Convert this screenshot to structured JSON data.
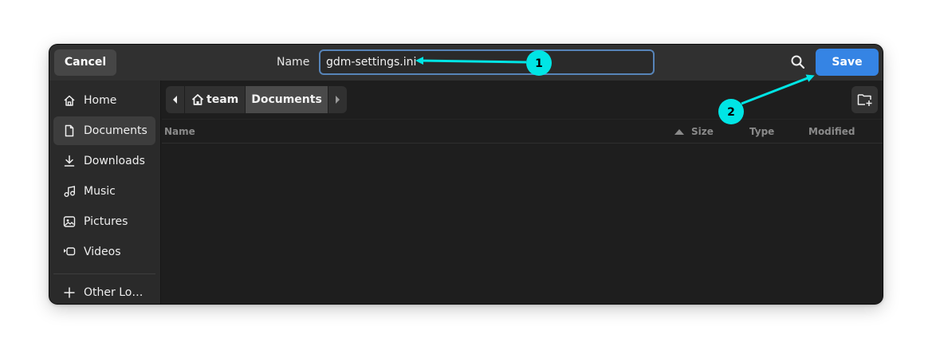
{
  "header": {
    "cancel_label": "Cancel",
    "name_label": "Name",
    "name_value": "gdm-settings.ini",
    "search_icon": "search-icon",
    "save_label": "Save"
  },
  "sidebar": {
    "items": [
      {
        "label": "Home",
        "icon": "home-icon"
      },
      {
        "label": "Documents",
        "icon": "document-icon",
        "active": true
      },
      {
        "label": "Downloads",
        "icon": "download-icon"
      },
      {
        "label": "Music",
        "icon": "music-icon"
      },
      {
        "label": "Pictures",
        "icon": "picture-icon"
      },
      {
        "label": "Videos",
        "icon": "video-icon"
      },
      {
        "label": "Other Lo…",
        "icon": "plus-icon"
      }
    ]
  },
  "pathbar": {
    "home_label": "team",
    "current_label": "Documents"
  },
  "columns": {
    "name": "Name",
    "size": "Size",
    "type": "Type",
    "modified": "Modified"
  },
  "annotations": {
    "step1": "1",
    "step2": "2",
    "color": "#00e5e5"
  },
  "colors": {
    "accent": "#3584e4",
    "window_bg": "#1e1e1e",
    "headerbar_bg": "#303030",
    "sidebar_bg": "#2a2a2a"
  }
}
